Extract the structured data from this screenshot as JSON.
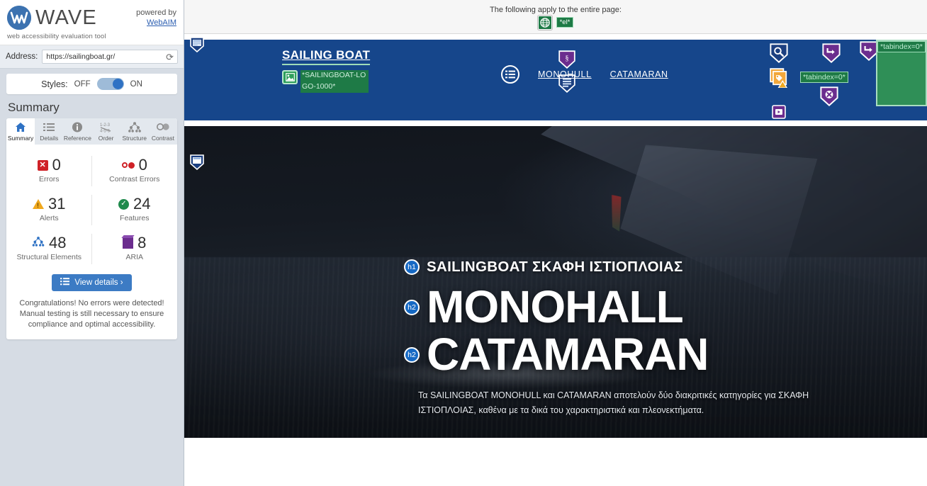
{
  "sidebar": {
    "brand": {
      "name": "WAVE",
      "tagline": "web accessibility evaluation tool",
      "logo_icon": "wave-logo-icon"
    },
    "powered": {
      "prefix": "powered by",
      "link": "WebAIM"
    },
    "address": {
      "label": "Address:",
      "value": "https://sailingboat.gr/",
      "placeholder": "https://",
      "reload_icon": "reload-icon"
    },
    "styles": {
      "label": "Styles:",
      "off": "OFF",
      "on": "ON",
      "state": "on"
    },
    "summary_title": "Summary",
    "tabs": [
      {
        "label": "Summary",
        "icon": "home-icon",
        "active": true
      },
      {
        "label": "Details",
        "icon": "list-icon",
        "active": false
      },
      {
        "label": "Reference",
        "icon": "info-icon",
        "active": false
      },
      {
        "label": "Order",
        "icon": "order-icon",
        "active": false
      },
      {
        "label": "Structure",
        "icon": "structure-icon",
        "active": false
      },
      {
        "label": "Contrast",
        "icon": "contrast-icon",
        "active": false
      }
    ],
    "stats": [
      {
        "label": "Errors",
        "value": "0",
        "icon": "error-icon",
        "color": "#cf2127"
      },
      {
        "label": "Contrast Errors",
        "value": "0",
        "icon": "contrast-error-icon",
        "color": "#cf2127"
      },
      {
        "label": "Alerts",
        "value": "31",
        "icon": "alert-icon",
        "color": "#f0a81d"
      },
      {
        "label": "Features",
        "value": "24",
        "icon": "feature-icon",
        "color": "#1f8a4c"
      },
      {
        "label": "Structural Elements",
        "value": "48",
        "icon": "structure-icon",
        "color": "#2f72c4"
      },
      {
        "label": "ARIA",
        "value": "8",
        "icon": "aria-icon",
        "color": "#6b2d8e"
      }
    ],
    "view_details": {
      "label": "View details ›",
      "icon": "list-icon"
    },
    "congrats": "Congratulations! No errors were detected! Manual testing is still necessary to ensure compliance and optimal accessibility."
  },
  "page_note": {
    "text": "The following apply to the entire page:",
    "icons": [
      {
        "name": "language-globe-icon",
        "type": "feature"
      },
      {
        "name": "lang-code-badge",
        "label": "*el*"
      }
    ]
  },
  "site": {
    "logo_text": "SAILING BOAT",
    "logo_alt": "*SAILINGBOAT-LOGO-1000*",
    "nav": {
      "menu_icon": "hamburger-menu-icon",
      "links": [
        "MONOHULL",
        "CATAMARAN"
      ]
    },
    "header_icons": [
      {
        "name": "search-icon",
        "type": "feature"
      },
      {
        "name": "alt-text-warning-icon",
        "type": "alert"
      },
      {
        "name": "redundant-link-icon",
        "type": "aria"
      },
      {
        "name": "noscript-icon",
        "type": "aria"
      },
      {
        "name": "redundant-link-icon-2",
        "type": "aria"
      },
      {
        "name": "video-icon",
        "type": "aria"
      }
    ],
    "tabindex_badges": [
      "*tabindex=0*",
      "*tabindex=0*"
    ],
    "structure_markers": [
      "header-region-marker",
      "main-region-marker"
    ]
  },
  "hero": {
    "h1": {
      "badge": "h1",
      "text": "SAILINGBOAT ΣΚΑΦΗ ΙΣΤΙΟΠΛΟΙΑΣ"
    },
    "h2_first": {
      "badge": "h2",
      "text": "MONOHALL"
    },
    "h2_second": {
      "badge": "h2",
      "text": "CATAMARAN"
    },
    "paragraph": "Τα SAILINGBOAT MONOHULL και CATAMARAN αποτελούν δύο διακριτικές κατηγορίες για ΣΚΑΦΗ ΙΣΤΙΟΠΛΟΙΑΣ, καθένα με τα δικά του χαρακτηριστικά και πλεονεκτήματα."
  },
  "colors": {
    "header_blue": "#16468b",
    "wave_blue": "#3c7bc4",
    "feature_green": "#1e7a46",
    "alert_orange": "#f0a81d",
    "error_red": "#cf2127",
    "aria_purple": "#6b2d8e"
  }
}
